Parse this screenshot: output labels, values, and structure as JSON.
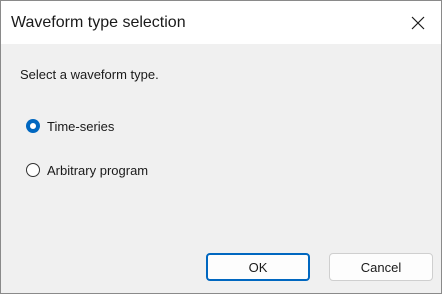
{
  "window": {
    "title": "Waveform type selection",
    "close_icon": "close-icon"
  },
  "prompt": "Select a waveform type.",
  "options": [
    {
      "label": "Time-series",
      "selected": true
    },
    {
      "label": "Arbitrary program",
      "selected": false
    }
  ],
  "buttons": {
    "ok_label": "OK",
    "cancel_label": "Cancel"
  },
  "colors": {
    "accent": "#0067c0",
    "dialog_background": "#f0f0f0",
    "titlebar_background": "#ffffff"
  }
}
